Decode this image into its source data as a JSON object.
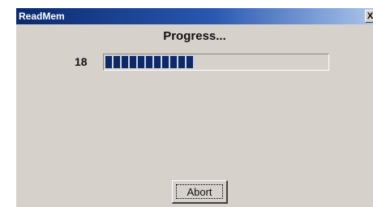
{
  "window": {
    "title": "ReadMem",
    "close_glyph": "X"
  },
  "dialog": {
    "heading": "Progress...",
    "count": "18",
    "progress_fraction": 0.39,
    "abort_label": "Abort"
  },
  "colors": {
    "titlebar_dark": "#0b2a6e",
    "titlebar_light": "#a9c3ea",
    "progress_fill": "#0b2a6e",
    "dialog_background": "#d6d1cb"
  }
}
